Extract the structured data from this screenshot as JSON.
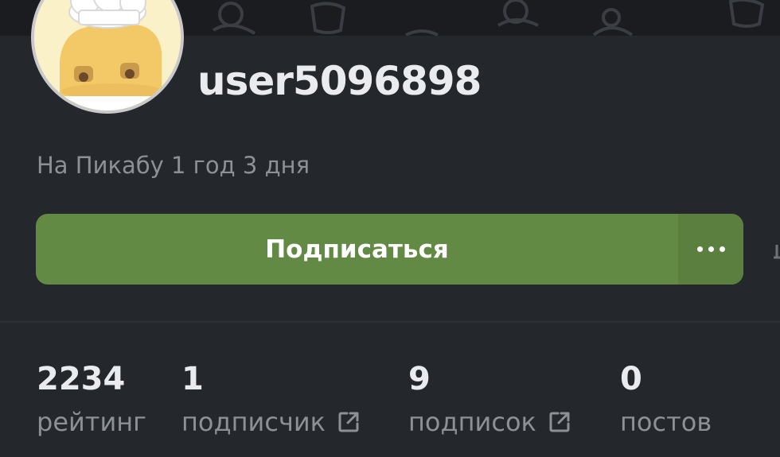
{
  "profile": {
    "username": "user5096898",
    "since": "На Пикабу 1 год 3 дня"
  },
  "actions": {
    "subscribe_label": "Подписаться",
    "more_icon": "ellipsis-icon"
  },
  "stats": [
    {
      "value": "2234",
      "label": "рейтинг",
      "external": false
    },
    {
      "value": "1",
      "label": "подписчик",
      "external": true
    },
    {
      "value": "9",
      "label": "подписок",
      "external": true
    },
    {
      "value": "0",
      "label": "постов",
      "external": false
    }
  ],
  "colors": {
    "background": "#24272b",
    "cover": "#1a1c1f",
    "accent_green": "#628a44",
    "text_primary": "#e9ebee",
    "text_secondary": "#8c9197"
  }
}
